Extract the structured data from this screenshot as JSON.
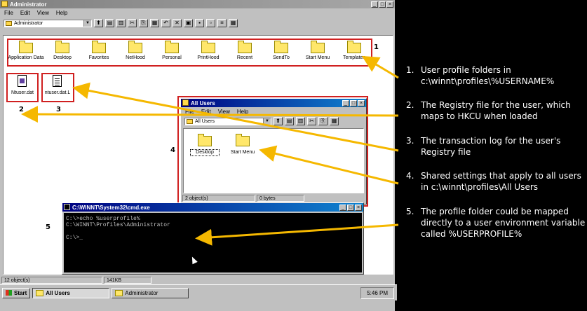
{
  "explorer": {
    "title": "Administrator",
    "menu": [
      "File",
      "Edit",
      "View",
      "Help"
    ],
    "address": "Administrator",
    "folders": [
      "Application Data",
      "Desktop",
      "Favorites",
      "NetHood",
      "Personal",
      "PrintHood",
      "Recent",
      "SendTo",
      "Start Menu",
      "Templates"
    ],
    "files": [
      "Ntuser.dat",
      "ntuser.dat.L"
    ],
    "status": {
      "objects": "12 object(s)",
      "size": "141KB"
    }
  },
  "allusers": {
    "title": "All Users",
    "menu": [
      "File",
      "Edit",
      "View",
      "Help"
    ],
    "address": "All Users",
    "folders": [
      "Desktop",
      "Start Menu"
    ],
    "status": {
      "objects": "2 object(s)",
      "size": "0 bytes"
    }
  },
  "cmd": {
    "title": "C:\\WINNT\\System32\\cmd.exe",
    "lines": "C:\\>echo %userprofile%\nC:\\WINNT\\Profiles\\Administrator\n\nC:\\>_"
  },
  "taskbar": {
    "start": "Start",
    "tasks": [
      "All Users",
      "Administrator"
    ],
    "clock": "5:46 PM"
  },
  "callouts": [
    "1",
    "2",
    "3",
    "4",
    "5"
  ],
  "annotations": [
    {
      "num": "1.",
      "line1": "User profile folders in",
      "line2": "c:\\winnt\\profiles\\%USERNAME%"
    },
    {
      "num": "2.",
      "line1": "The Registry file for the user, which",
      "line2": "maps to HKCU when loaded"
    },
    {
      "num": "3.",
      "line1": "The transaction log for the user's",
      "line2": "Registry file"
    },
    {
      "num": "4.",
      "line1": "Shared settings that apply to all users",
      "line2": "in c:\\winnt\\profiles\\All Users"
    },
    {
      "num": "5.",
      "line1": "The profile folder could be mapped",
      "line2": "directly to a user environment variable",
      "line3": "called %USERPROFILE%"
    }
  ],
  "colors": {
    "highlight": "#d02020",
    "arrow": "#f5b800",
    "titlebar": "#000080"
  }
}
